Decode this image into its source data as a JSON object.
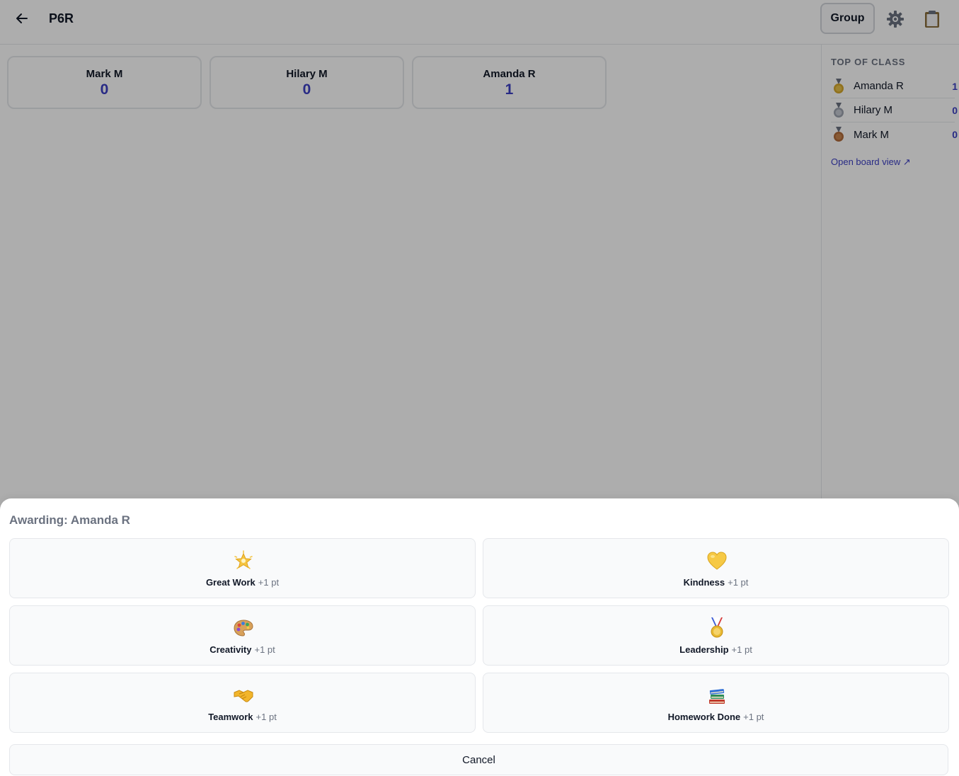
{
  "header": {
    "title": "P6R",
    "group_label": "Group",
    "back_icon": "arrow-left-icon",
    "settings_icon": "gear-icon",
    "clipboard_icon": "clipboard-icon"
  },
  "students": [
    {
      "name": "Mark M",
      "points": "0"
    },
    {
      "name": "Hilary M",
      "points": "0"
    },
    {
      "name": "Amanda R",
      "points": "1"
    }
  ],
  "sidebar": {
    "title": "TOP OF CLASS",
    "ranks": [
      {
        "medal": "gold-medal-icon",
        "name": "Amanda R",
        "points": "1"
      },
      {
        "medal": "silver-medal-icon",
        "name": "Hilary M",
        "points": "0"
      },
      {
        "medal": "bronze-medal-icon",
        "name": "Mark M",
        "points": "0"
      }
    ],
    "board_link": "Open board view ↗"
  },
  "sheet": {
    "title": "Awarding: Amanda R",
    "awards": [
      {
        "name": "Great Work",
        "points": "+1 pt",
        "icon": "glowing-star-icon"
      },
      {
        "name": "Kindness",
        "points": "+1 pt",
        "icon": "yellow-heart-icon"
      },
      {
        "name": "Creativity",
        "points": "+1 pt",
        "icon": "artist-palette-icon"
      },
      {
        "name": "Leadership",
        "points": "+1 pt",
        "icon": "medal-icon"
      },
      {
        "name": "Teamwork",
        "points": "+1 pt",
        "icon": "handshake-icon"
      },
      {
        "name": "Homework Done",
        "points": "+1 pt",
        "icon": "books-icon"
      }
    ],
    "cancel_label": "Cancel"
  },
  "colors": {
    "accent": "#3b3fc4",
    "overlay": "#000000",
    "muted_text": "#6b7280",
    "border": "#e5e7eb",
    "gold": "#d4a72c",
    "silver": "#9ca3af",
    "bronze": "#b06a3a"
  }
}
